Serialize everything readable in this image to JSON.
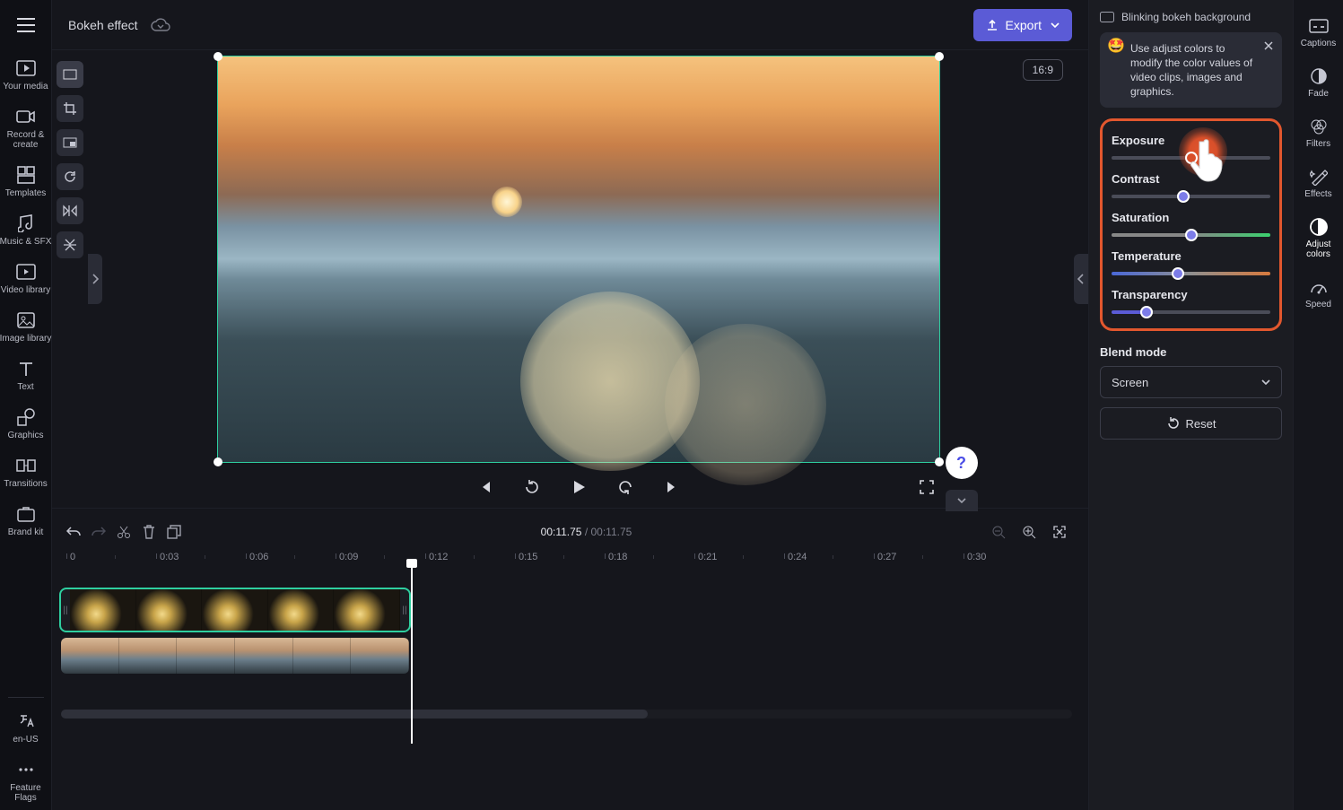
{
  "header": {
    "title": "Bokeh effect",
    "export_label": "Export"
  },
  "leftRail": {
    "items": [
      {
        "label": "Your media"
      },
      {
        "label": "Record & create"
      },
      {
        "label": "Templates"
      },
      {
        "label": "Music & SFX"
      },
      {
        "label": "Video library"
      },
      {
        "label": "Image library"
      },
      {
        "label": "Text"
      },
      {
        "label": "Graphics"
      },
      {
        "label": "Transitions"
      },
      {
        "label": "Brand kit"
      }
    ],
    "locale": "en-US",
    "featureFlags": "Feature Flags"
  },
  "canvas": {
    "aspect": "16:9"
  },
  "timeline": {
    "current": "00:11.75",
    "total": "00:11.75",
    "ticks": [
      "0",
      "0:03",
      "0:06",
      "0:09",
      "0:12",
      "0:15",
      "0:18",
      "0:21",
      "0:24",
      "0:27",
      "0:30"
    ]
  },
  "props": {
    "clipTitle": "Blinking bokeh background",
    "tip": "Use adjust colors to modify the color values of video clips, images and graphics.",
    "sliders": {
      "exposure": {
        "label": "Exposure",
        "pos": 50
      },
      "contrast": {
        "label": "Contrast",
        "pos": 45
      },
      "saturation": {
        "label": "Saturation",
        "pos": 50
      },
      "temperature": {
        "label": "Temperature",
        "pos": 42
      },
      "transparency": {
        "label": "Transparency",
        "pos": 22
      }
    },
    "blendMode": {
      "label": "Blend mode",
      "value": "Screen"
    },
    "reset": "Reset"
  },
  "rightRail": {
    "items": [
      {
        "label": "Captions"
      },
      {
        "label": "Fade"
      },
      {
        "label": "Filters"
      },
      {
        "label": "Effects"
      },
      {
        "label": "Adjust colors",
        "active": true
      },
      {
        "label": "Speed"
      }
    ]
  }
}
